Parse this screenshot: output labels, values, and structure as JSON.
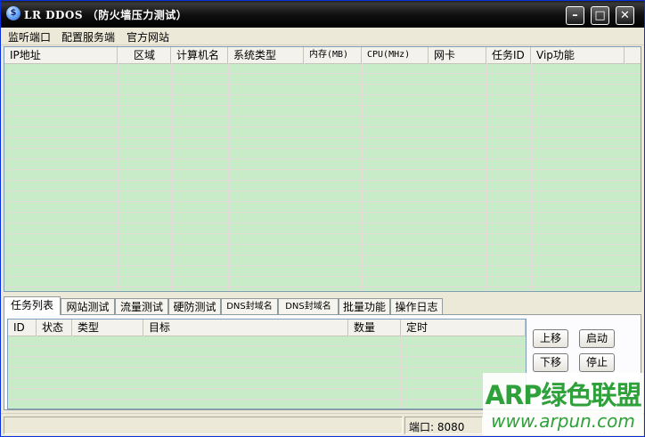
{
  "window": {
    "title": "LR DDOS （防火墙压力测试）",
    "icon_char": "$",
    "controls": {
      "minimize": "–",
      "maximize": "□",
      "close": "✕"
    }
  },
  "menu": [
    "监听端口",
    "配置服务端",
    "官方网站"
  ],
  "main_list": {
    "columns": [
      "IP地址",
      "区域",
      "计算机名",
      "系统类型",
      "内存(MB)",
      "CPU(MHz)",
      "网卡",
      "任务ID",
      "Vip功能"
    ]
  },
  "tabs": [
    "任务列表",
    "网站测试",
    "流量测试",
    "硬防测试",
    "DNS封域名",
    "DNS封域名",
    "批量功能",
    "操作日志"
  ],
  "task_list": {
    "columns": [
      "ID",
      "状态",
      "类型",
      "目标",
      "数量",
      "定时"
    ]
  },
  "buttons": {
    "move_up": "上移",
    "start": "启动",
    "move_down": "下移",
    "stop": "停止"
  },
  "status": {
    "port": "端口: 8080"
  },
  "watermark": {
    "line1": "ARP绿色联盟",
    "line2": "www.arpun.com"
  },
  "colors": {
    "list_bg": "#c8ecc8",
    "title_bar": "#000000",
    "watermark": "#2fa13a"
  }
}
